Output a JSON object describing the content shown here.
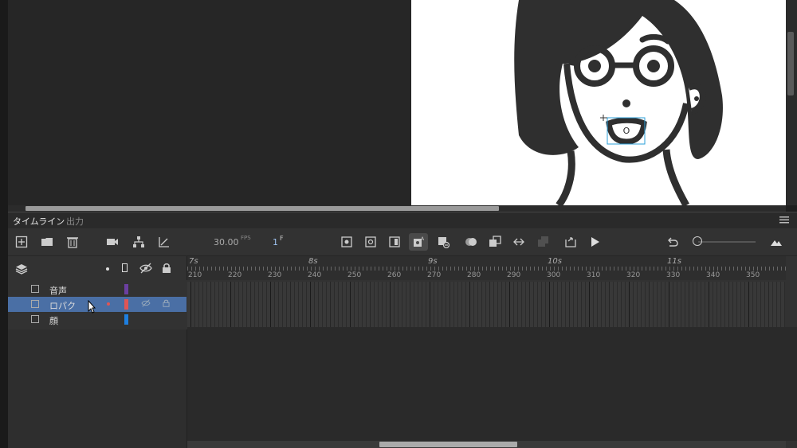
{
  "tabs": [
    {
      "label": "タイムライン"
    },
    {
      "label": "出力"
    }
  ],
  "toolbar": {
    "fps_value": "30.00",
    "fps_label": "FPS",
    "frame_value": "1",
    "frame_label": "F"
  },
  "ruler": {
    "seconds": [
      "7s",
      "8s",
      "9s",
      "10s",
      "11s"
    ],
    "frames": [
      "210",
      "220",
      "230",
      "240",
      "250",
      "260",
      "270",
      "280",
      "290",
      "300",
      "310",
      "320",
      "330",
      "340",
      "350"
    ]
  },
  "layers": [
    {
      "name": "音声",
      "color": "#6b3fa0"
    },
    {
      "name": "ロパク",
      "color": "#e05555"
    },
    {
      "name": "顔",
      "color": "#1e7fe0"
    }
  ],
  "colors": {
    "selected_row": "#4a6fa5",
    "panel_bg": "#323232"
  },
  "stage": {
    "mouth_symbol": "O"
  }
}
